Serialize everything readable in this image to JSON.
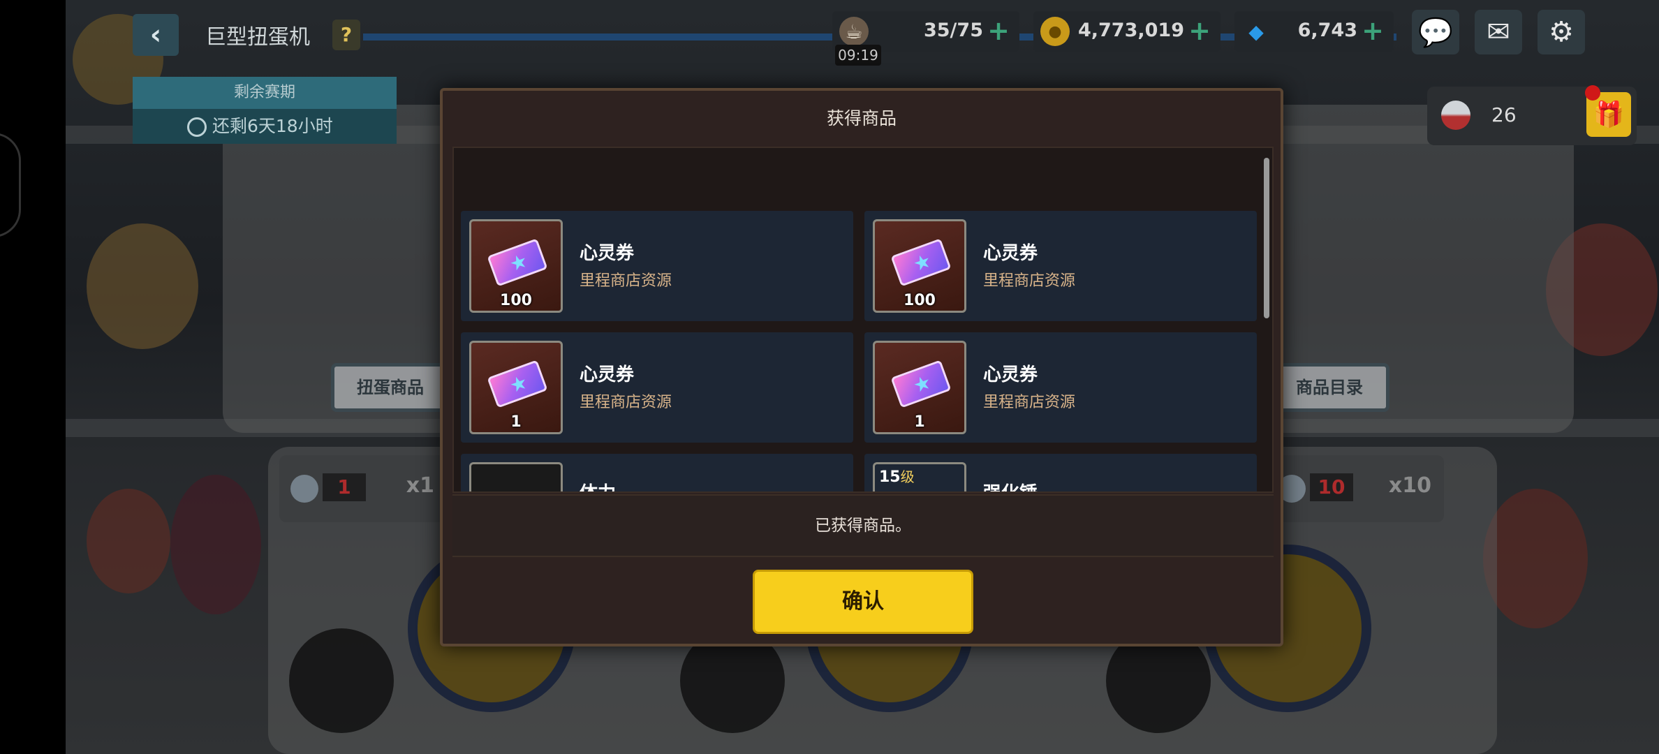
{
  "header": {
    "title": "巨型扭蛋机",
    "help": "?",
    "stamina": "35/75",
    "stamina_timer": "09:19",
    "gold": "4,773,019",
    "gems": "6,743",
    "plus": "+"
  },
  "season": {
    "label": "剩余赛期",
    "remaining": "还剩6天18小时"
  },
  "coupon": {
    "count": "26"
  },
  "background": {
    "left_label": "扭蛋商品",
    "right_label": "商品目录",
    "left_count": "1",
    "left_multiplier": "x1",
    "right_count": "10",
    "right_multiplier": "x10"
  },
  "modal": {
    "title": "获得商品",
    "items": [
      {
        "name": "心灵券",
        "desc": "里程商店资源",
        "qty": "100"
      },
      {
        "name": "心灵券",
        "desc": "里程商店资源",
        "qty": "100"
      },
      {
        "name": "心灵券",
        "desc": "里程商店资源",
        "qty": "1"
      },
      {
        "name": "心灵券",
        "desc": "里程商店资源",
        "qty": "1"
      },
      {
        "name": "体力",
        "desc": "",
        "qty": ""
      },
      {
        "name": "强化锤",
        "desc": "",
        "qty": "",
        "level": "15",
        "level_unit": "级"
      }
    ],
    "message": "已获得商品。",
    "confirm": "确认"
  },
  "colors": {
    "confirm": "#f7ce1c",
    "item_bg": "#1d2634",
    "desc_text": "#d9b48a",
    "modal_bg": "#2e2220"
  }
}
